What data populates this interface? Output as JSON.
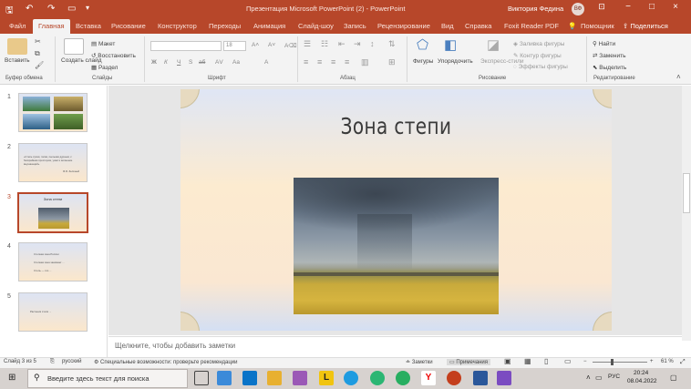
{
  "window": {
    "title": "Презентация Microsoft PowerPoint (2)  -  PowerPoint",
    "user": "Виктория Федина",
    "avatar_initials": "ВФ",
    "search_label": "Помощник",
    "share": "Поделиться"
  },
  "tabs": [
    "Файл",
    "Главная",
    "Вставка",
    "Рисование",
    "Конструктор",
    "Переходы",
    "Анимация",
    "Слайд-шоу",
    "Запись",
    "Рецензирование",
    "Вид",
    "Справка",
    "Foxit Reader PDF"
  ],
  "ribbon": {
    "paste": "Вставить",
    "create_slide": "Создать слайд",
    "layout": "Макет",
    "reset": "Восстановить",
    "section": "Раздел",
    "font_size": "18",
    "shapes": "Фигуры",
    "arrange": "Упорядочить",
    "quick_styles": "Экспресс-стили",
    "shape_fill": "Заливка фигуры",
    "shape_outline": "Контур фигуры",
    "shape_effects": "Эффекты фигуры",
    "find": "Найти",
    "replace": "Заменить",
    "select": "Выделить",
    "groups": {
      "clipboard": "Буфер обмена",
      "slides": "Слайды",
      "font": "Шрифт",
      "paragraph": "Абзац",
      "drawing": "Рисование",
      "editing": "Редактирование"
    },
    "font_buttons": [
      "Ж",
      "К",
      "Ч",
      "S",
      "аб",
      "АV",
      "Аа",
      "А"
    ]
  },
  "thumbnails": [
    {
      "num": "1"
    },
    {
      "num": "2",
      "text": "«Степь сухая, голая, пыльная дурным, с бескрайним простором, ужас и волнение внушающий»",
      "author": "Ф.Я. Зелёный"
    },
    {
      "num": "3",
      "text": "Зона степи"
    },
    {
      "num": "4",
      "line1": "Степная зона России",
      "line2": "Степная зона занимает ...",
      "line3": "Степь — это ..."
    },
    {
      "num": "5",
      "text": "Растения степи ..."
    }
  ],
  "slide": {
    "title": "Зона степи"
  },
  "notes_placeholder": "Щелкните, чтобы добавить заметки",
  "status": {
    "slide_count": "Слайд 3 из 5",
    "language": "русский",
    "accessibility": "Специальные возможности: проверьте рекомендации",
    "notes": "Заметки",
    "comments": "Примечания",
    "zoom": "61 %"
  },
  "taskbar": {
    "search_placeholder": "Введите здесь текст для поиска",
    "lang": "РУС",
    "time": "20:24",
    "date": "08.04.2022"
  },
  "colors": {
    "accent": "#b7472a",
    "ribbon": "#f3f3f3",
    "taskbar": "#d7d2cf"
  }
}
